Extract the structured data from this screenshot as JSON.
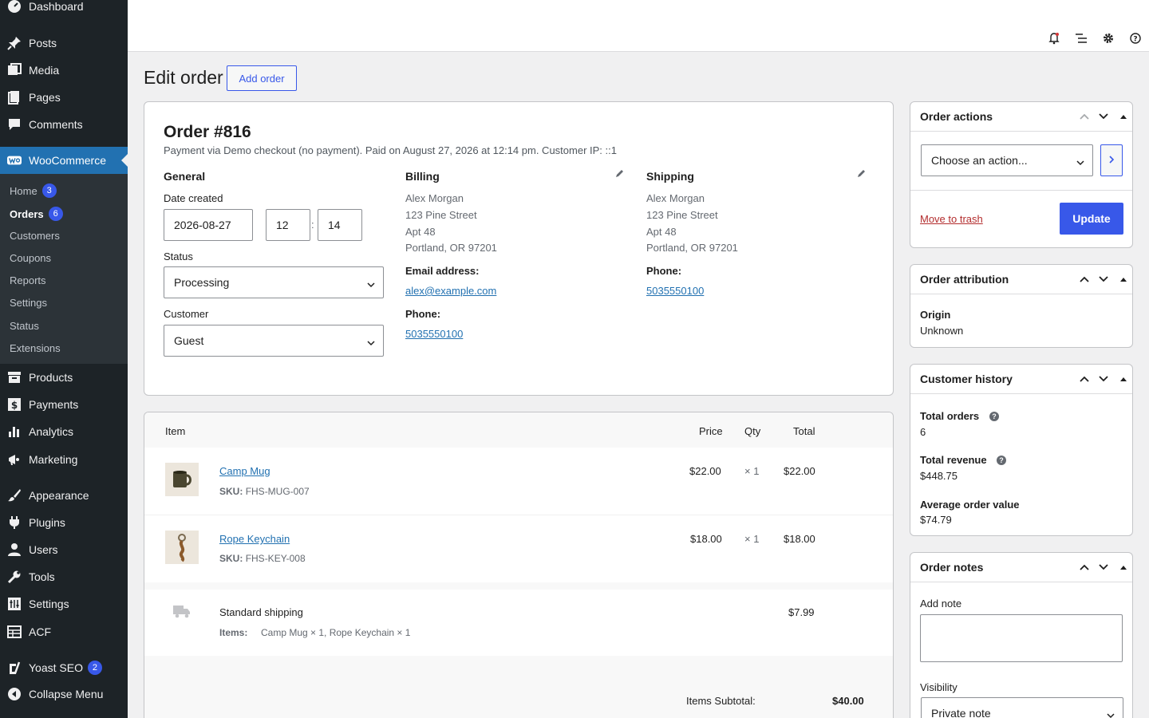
{
  "sidebar": {
    "dashboard": "Dashboard",
    "posts": "Posts",
    "media": "Media",
    "pages": "Pages",
    "comments": "Comments",
    "woocommerce": "WooCommerce",
    "sub": {
      "home": "Home",
      "home_count": "3",
      "orders": "Orders",
      "orders_count": "6",
      "customers": "Customers",
      "coupons": "Coupons",
      "reports": "Reports",
      "settings": "Settings",
      "status": "Status",
      "extensions": "Extensions"
    },
    "products": "Products",
    "payments": "Payments",
    "analytics": "Analytics",
    "marketing": "Marketing",
    "appearance": "Appearance",
    "plugins": "Plugins",
    "users": "Users",
    "tools": "Tools",
    "settings": "Settings",
    "acf": "ACF",
    "yoast": "Yoast SEO",
    "yoast_count": "2",
    "collapse": "Collapse Menu"
  },
  "header": {
    "title": "Edit order",
    "add_order": "Add order"
  },
  "order": {
    "title": "Order #816",
    "meta": "Payment via Demo checkout (no payment). Paid on August 27, 2026 at 12:14 pm. Customer IP: ::1",
    "general": {
      "heading": "General",
      "date_label": "Date created",
      "date": "2026-08-27",
      "hour": "12",
      "minute": "14",
      "time_sep": ":",
      "status_label": "Status",
      "status": "Processing",
      "customer_label": "Customer",
      "customer": "Guest"
    },
    "billing": {
      "heading": "Billing",
      "name": "Alex Morgan",
      "line1": "123 Pine Street",
      "line2": "Apt 48",
      "city": "Portland, OR 97201",
      "email_label": "Email address:",
      "email": "alex@example.com",
      "phone_label": "Phone:",
      "phone": "5035550100"
    },
    "shipping": {
      "heading": "Shipping",
      "name": "Alex Morgan",
      "line1": "123 Pine Street",
      "line2": "Apt 48",
      "city": "Portland, OR 97201",
      "phone_label": "Phone:",
      "phone": "5035550100"
    }
  },
  "items": {
    "headers": {
      "item": "Item",
      "price": "Price",
      "qty": "Qty",
      "total": "Total"
    },
    "rows": [
      {
        "name": "Camp Mug",
        "sku_label": "SKU:",
        "sku": "FHS-MUG-007",
        "price": "$22.00",
        "qty": "× 1",
        "total": "$22.00"
      },
      {
        "name": "Rope Keychain",
        "sku_label": "SKU:",
        "sku": "FHS-KEY-008",
        "price": "$18.00",
        "qty": "× 1",
        "total": "$18.00"
      }
    ],
    "shipping": {
      "name": "Standard shipping",
      "items_label": "Items:",
      "items": "Camp Mug × 1, Rope Keychain × 1",
      "total": "$7.99"
    },
    "subtotal_label": "Items Subtotal:",
    "subtotal": "$40.00"
  },
  "actions": {
    "title": "Order actions",
    "select": "Choose an action...",
    "trash": "Move to trash",
    "update": "Update"
  },
  "attribution": {
    "title": "Order attribution",
    "origin_label": "Origin",
    "origin": "Unknown"
  },
  "history": {
    "title": "Customer history",
    "total_orders_label": "Total orders",
    "total_orders": "6",
    "total_revenue_label": "Total revenue",
    "total_revenue": "$448.75",
    "aov_label": "Average order value",
    "aov": "$74.79"
  },
  "notes": {
    "title": "Order notes",
    "add_label": "Add note",
    "visibility_label": "Visibility",
    "visibility": "Private note"
  },
  "colors": {
    "accent": "#3858e9",
    "link": "#2271b1",
    "sidebar": "#1d2327",
    "danger": "#b32d2e"
  }
}
